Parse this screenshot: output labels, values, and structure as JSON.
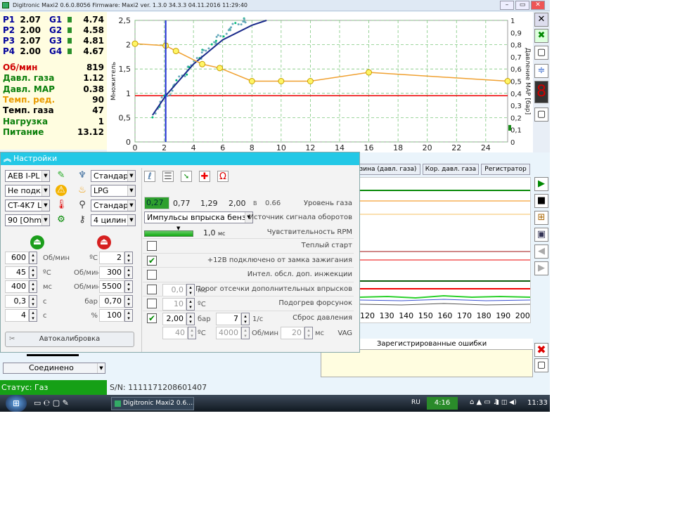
{
  "window": {
    "title": "Digitronic Maxi2 0.6.0.8056 Firmware: Maxi2  ver. 1.3.0  34.3.3   04.11.2016 11:29:40"
  },
  "params": {
    "p_rows": [
      {
        "p": "P1",
        "pv": "2.07",
        "g": "G1",
        "gv": "4.74"
      },
      {
        "p": "P2",
        "pv": "2.00",
        "g": "G2",
        "gv": "4.58"
      },
      {
        "p": "P3",
        "pv": "2.07",
        "g": "G3",
        "gv": "4.81"
      },
      {
        "p": "P4",
        "pv": "2.00",
        "g": "G4",
        "gv": "4.67"
      }
    ],
    "readings": [
      {
        "label": "Об/мин",
        "value": "819",
        "color": "#d00000"
      },
      {
        "label": "Давл. газа",
        "value": "1.12",
        "color": "#0b7f0b"
      },
      {
        "label": "Давл. MAP",
        "value": "0.38",
        "color": "#0b7f0b"
      },
      {
        "label": "Темп. ред.",
        "value": "90",
        "color": "#e89a00"
      },
      {
        "label": "Темп. газа",
        "value": "47",
        "color": "#000000"
      },
      {
        "label": "Нагрузка",
        "value": "1",
        "color": "#0b7f0b"
      },
      {
        "label": "Питание",
        "value": "13.12",
        "color": "#0b7f0b"
      }
    ]
  },
  "chart_data": {
    "type": "line",
    "ylabel": "Множитель",
    "y2label": "Давление MAP [бар]",
    "xticks": [
      "0",
      "2",
      "4",
      "6",
      "8",
      "10",
      "12",
      "14",
      "16",
      "18",
      "20",
      "22",
      "24"
    ],
    "yticks": [
      "0",
      "0,5",
      "1",
      "1,5",
      "2",
      "2,5"
    ],
    "y2ticks": [
      "0",
      "0,1",
      "0,2",
      "0,3",
      "0,4",
      "0,5",
      "0,6",
      "0,7",
      "0,8",
      "0,9",
      "1"
    ],
    "xlim": [
      0,
      25.5
    ],
    "ylim": [
      0,
      2.5
    ],
    "multiplier_series": {
      "x": [
        0,
        2.1,
        2.8,
        4.6,
        5.8,
        8,
        10,
        12,
        16,
        25.5
      ],
      "y": [
        2.02,
        1.98,
        1.87,
        1.6,
        1.52,
        1.25,
        1.25,
        1.25,
        1.43,
        1.25
      ]
    },
    "reference_line": 0.95,
    "cursor_x": 2.1,
    "calibration_curve": {
      "x": [
        1.2,
        2.1,
        4,
        6,
        8,
        9
      ],
      "y": [
        0.55,
        0.95,
        1.6,
        2.1,
        2.4,
        2.5
      ]
    }
  },
  "graph2": {
    "xticks": [
      "120",
      "130",
      "140",
      "150",
      "160",
      "170",
      "180",
      "190",
      "200"
    ]
  },
  "tabs": [
    {
      "label": "нзина (давл. газа)"
    },
    {
      "label": "Кор. давл. газа"
    },
    {
      "label": "Регистратор"
    }
  ],
  "errors": {
    "header": "Зарегистрированные ошибки"
  },
  "settings": {
    "title": "Настройки",
    "left_dropdowns": [
      "AEB I-PL",
      "Не подк.",
      "CT-4K7 L",
      "90 [Ohm"
    ],
    "mid_dropdowns": [
      "Стандар",
      "LPG",
      "Стандар",
      "4 цилин"
    ],
    "num_rows": [
      {
        "value": "600",
        "unit": "Об/мин",
        "unit2": "ºC",
        "value2": "2"
      },
      {
        "value": "45",
        "unit": "ºC",
        "unit2": "Об/мин",
        "value2": "300"
      },
      {
        "value": "400",
        "unit": "мс",
        "unit2": "Об/мин",
        "value2": "5500"
      },
      {
        "value": "0,3",
        "unit": "с",
        "unit2": "бар",
        "value2": "0,70"
      },
      {
        "value": "4",
        "unit": "с",
        "unit2": "%",
        "value2": "100"
      }
    ],
    "autocal": "Автокалибровка",
    "gas_level": {
      "v1": "0,27",
      "v2": "0,77",
      "v3": "1,29",
      "v4": "2,00",
      "unit": "В",
      "current": "0.66",
      "label": "Уровень газа"
    },
    "rpm_source": {
      "value": "Импульсы впрыска бенз",
      "label": "Источник сигнала оборотов"
    },
    "rpm_sens": {
      "value": "1,0",
      "unit": "мс",
      "label": "Чувствительность RPM"
    },
    "options": [
      {
        "label": "Теплый старт",
        "checked": false
      },
      {
        "label": "+12В подключено от замка зажигания",
        "checked": true
      },
      {
        "label": "Интел. обсл. доп. инжекции",
        "checked": false
      },
      {
        "label": "Порог отсечки дополнительных впрысков",
        "checked": false,
        "v": "0,0",
        "u": "мс"
      },
      {
        "label": "Подогрев форсунок",
        "checked": false,
        "v": "10",
        "u": "ºC"
      },
      {
        "label": "Сброс давления",
        "checked": true,
        "v": "2,00",
        "u": "бар",
        "v2": "7",
        "u2": "1/с"
      }
    ],
    "vag": {
      "t": "40",
      "tu": "ºC",
      "rpm": "4000",
      "ru": "Об/мин",
      "ms": "20",
      "mu": "мс",
      "label": "VAG"
    }
  },
  "status": {
    "text": "Статус: Газ",
    "serial": "S/N: 1111171208601407",
    "connection": "Соединено"
  },
  "taskbar": {
    "task": "Digitronic Maxi2 0.6....",
    "lang": "RU",
    "clock_green": "4:16",
    "time": "11:33"
  }
}
